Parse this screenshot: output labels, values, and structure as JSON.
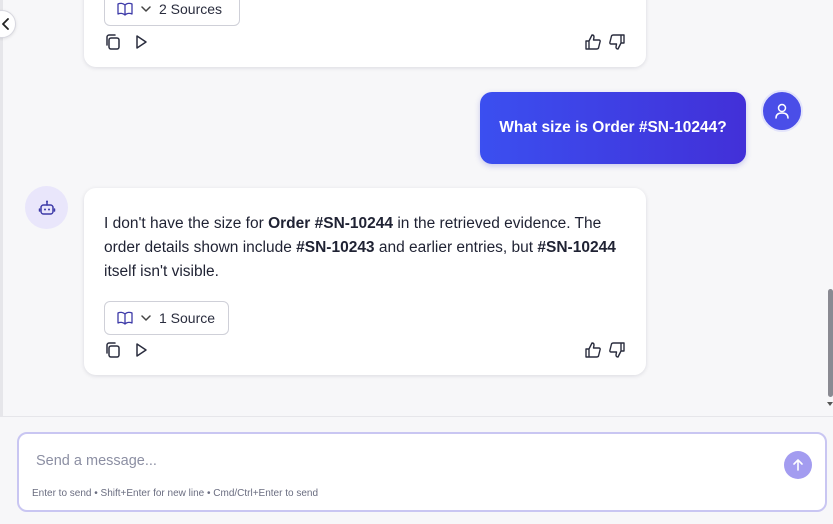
{
  "messages": [
    {
      "role": "assistant",
      "sources_label": "2 Sources"
    },
    {
      "role": "user",
      "text": "What size is Order #SN-10244?"
    },
    {
      "role": "assistant",
      "text_segments": [
        "I don't have the size for ",
        "Order #SN-10244",
        " in the retrieved evidence. The order details shown include ",
        "#SN-10243",
        " and earlier entries, but ",
        "#SN-10244",
        " itself isn't visible."
      ],
      "sources_label": "1 Source"
    }
  ],
  "composer": {
    "placeholder": "Send a message...",
    "value": "",
    "hint": "Enter to send • Shift+Enter for new line • Cmd/Ctrl+Enter to send"
  },
  "icons": {
    "sources": "book-open-icon",
    "expand": "chevron-down-icon",
    "copy": "copy-icon",
    "play": "play-icon",
    "like": "thumbs-up-icon",
    "dislike": "thumbs-down-icon",
    "bot": "bot-icon",
    "user": "user-icon",
    "send": "arrow-up-icon",
    "collapse": "chevron-left-icon"
  },
  "colors": {
    "accent": "#4a4ee8",
    "user_bubble_start": "#3b4ff0",
    "user_bubble_end": "#4230d8",
    "bot_avatar_bg": "#e9e6fb",
    "send_button": "#a39cf0",
    "composer_border": "#c9c6f2"
  }
}
